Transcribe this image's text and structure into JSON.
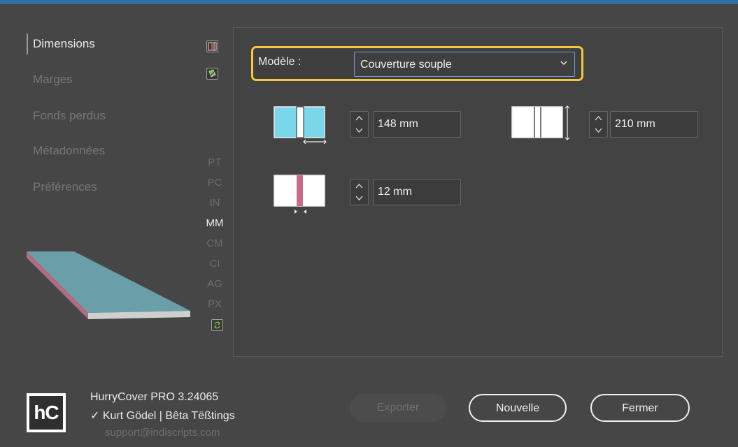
{
  "nav": {
    "items": [
      {
        "label": "Dimensions",
        "active": true
      },
      {
        "label": "Marges",
        "active": false
      },
      {
        "label": "Fonds perdus",
        "active": false
      },
      {
        "label": "Métadonnées",
        "active": false
      },
      {
        "label": "Préférences",
        "active": false
      }
    ]
  },
  "units": {
    "items": [
      "PT",
      "PC",
      "IN",
      "MM",
      "CM",
      "CI",
      "AG",
      "PX"
    ],
    "selected": "MM"
  },
  "model": {
    "label": "Modèle :",
    "value": "Couverture souple"
  },
  "dimensions": {
    "width_value": "148 mm",
    "height_value": "210 mm",
    "spine_value": "12 mm"
  },
  "footer": {
    "logo_text": "hC",
    "app_name": "HurryCover PRO 3.24065",
    "user": "✓ Kurt Gödel | Bêta Tëßtings",
    "email": "support@indiscripts.com"
  },
  "buttons": {
    "export": "Exporter",
    "new": "Nouvelle",
    "close": "Fermer"
  },
  "colors": {
    "accent_highlight": "#f5c73a",
    "cover_cyan": "#7ad7ea",
    "spine_pink": "#c96a8c",
    "background": "#464646"
  }
}
